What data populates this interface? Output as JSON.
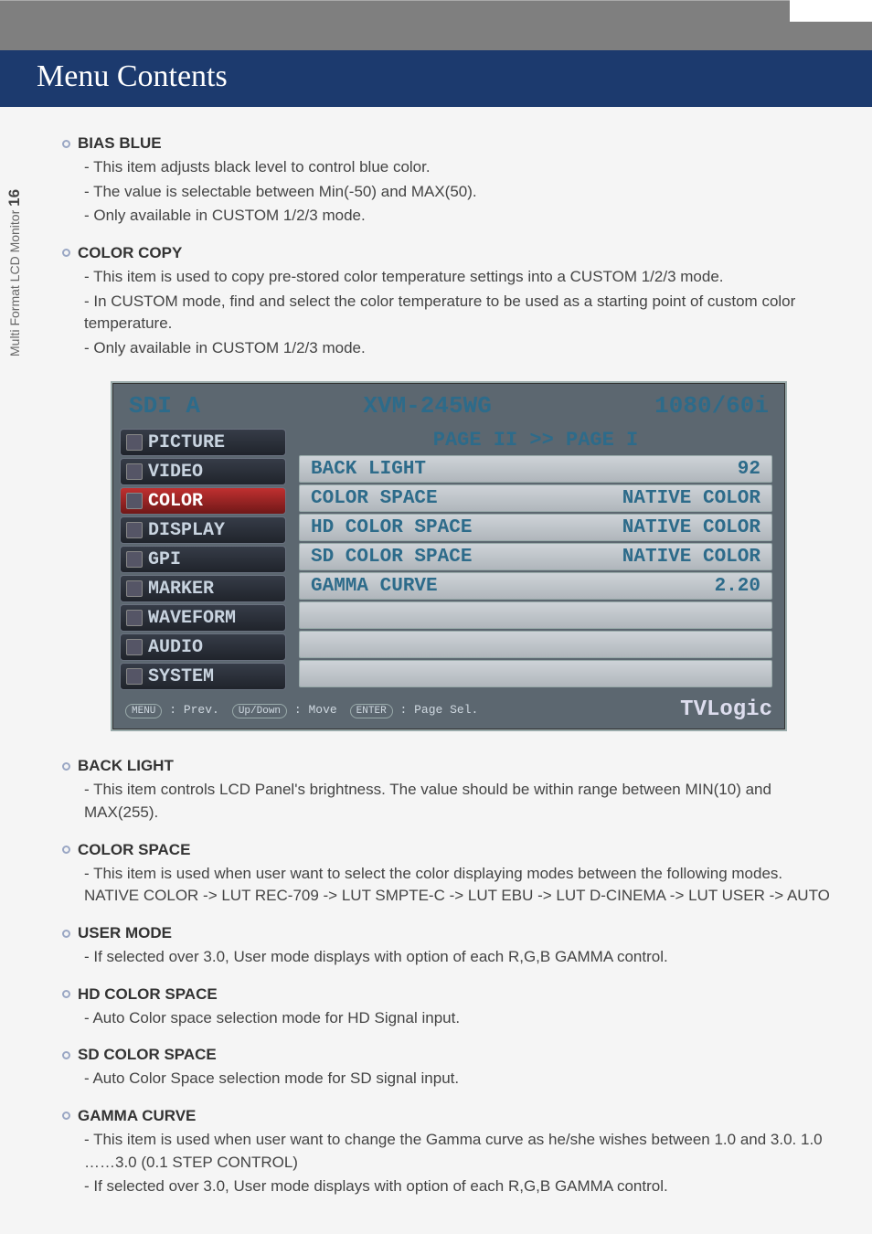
{
  "page": {
    "title_bar": "Menu Contents",
    "side_tab_text": "Multi Format LCD Monitor",
    "side_tab_page": "16"
  },
  "items_above": [
    {
      "title": "BIAS BLUE",
      "lines": [
        "- This item adjusts black level to control blue color.",
        "- The value is selectable between Min(-50) and MAX(50).",
        "- Only available in CUSTOM 1/2/3 mode."
      ]
    },
    {
      "title": "COLOR COPY",
      "lines": [
        "- This item is used to copy pre-stored color temperature settings into a CUSTOM 1/2/3 mode.",
        "- In CUSTOM mode, find and select the color temperature to be used as a starting point of custom color temperature.",
        "- Only available in CUSTOM 1/2/3 mode."
      ]
    }
  ],
  "osd": {
    "top_left": "SDI A",
    "top_center": "XVM-245WG",
    "top_right": "1080/60i",
    "page_indicator": "PAGE II >> PAGE I",
    "nav": [
      "PICTURE",
      "VIDEO",
      "COLOR",
      "DISPLAY",
      "GPI",
      "MARKER",
      "WAVEFORM",
      "AUDIO",
      "SYSTEM"
    ],
    "nav_selected_index": 2,
    "rows": [
      {
        "label": "BACK LIGHT",
        "value": "92"
      },
      {
        "label": "COLOR SPACE",
        "value": "NATIVE COLOR"
      },
      {
        "label": "HD COLOR SPACE",
        "value": "NATIVE COLOR"
      },
      {
        "label": "SD COLOR SPACE",
        "value": "NATIVE COLOR"
      },
      {
        "label": "GAMMA CURVE",
        "value": "2.20"
      }
    ],
    "footer": {
      "hint_menu_key": "MENU",
      "hint_menu_text": ": Prev.",
      "hint_move_key": "Up/Down",
      "hint_move_text": ": Move",
      "hint_enter_key": "ENTER",
      "hint_enter_text": ": Page Sel.",
      "brand": "TVLogic"
    }
  },
  "items_below": [
    {
      "title": "BACK LIGHT",
      "lines": [
        "- This item controls LCD Panel's brightness. The value should be within range between MIN(10) and MAX(255)."
      ]
    },
    {
      "title": "COLOR SPACE",
      "lines": [
        "- This item is used when user want to select the color displaying modes between the following modes. NATIVE COLOR -> LUT REC-709 -> LUT SMPTE-C -> LUT EBU -> LUT D-CINEMA -> LUT USER -> AUTO"
      ]
    },
    {
      "title": "USER MODE",
      "lines": [
        "- If selected over 3.0, User mode displays with option of each R,G,B GAMMA control."
      ]
    },
    {
      "title": "HD COLOR SPACE",
      "lines": [
        "- Auto Color space selection mode for HD Signal input."
      ]
    },
    {
      "title": "SD COLOR SPACE",
      "lines": [
        "- Auto Color Space selection mode for SD signal input."
      ]
    },
    {
      "title": "GAMMA CURVE",
      "lines": [
        "- This item is used when user want to change the Gamma curve as he/she wishes between 1.0 and 3.0. 1.0 ……3.0 (0.1 STEP CONTROL)",
        "- If selected over 3.0, User mode displays with option of each R,G,B GAMMA control."
      ]
    }
  ]
}
